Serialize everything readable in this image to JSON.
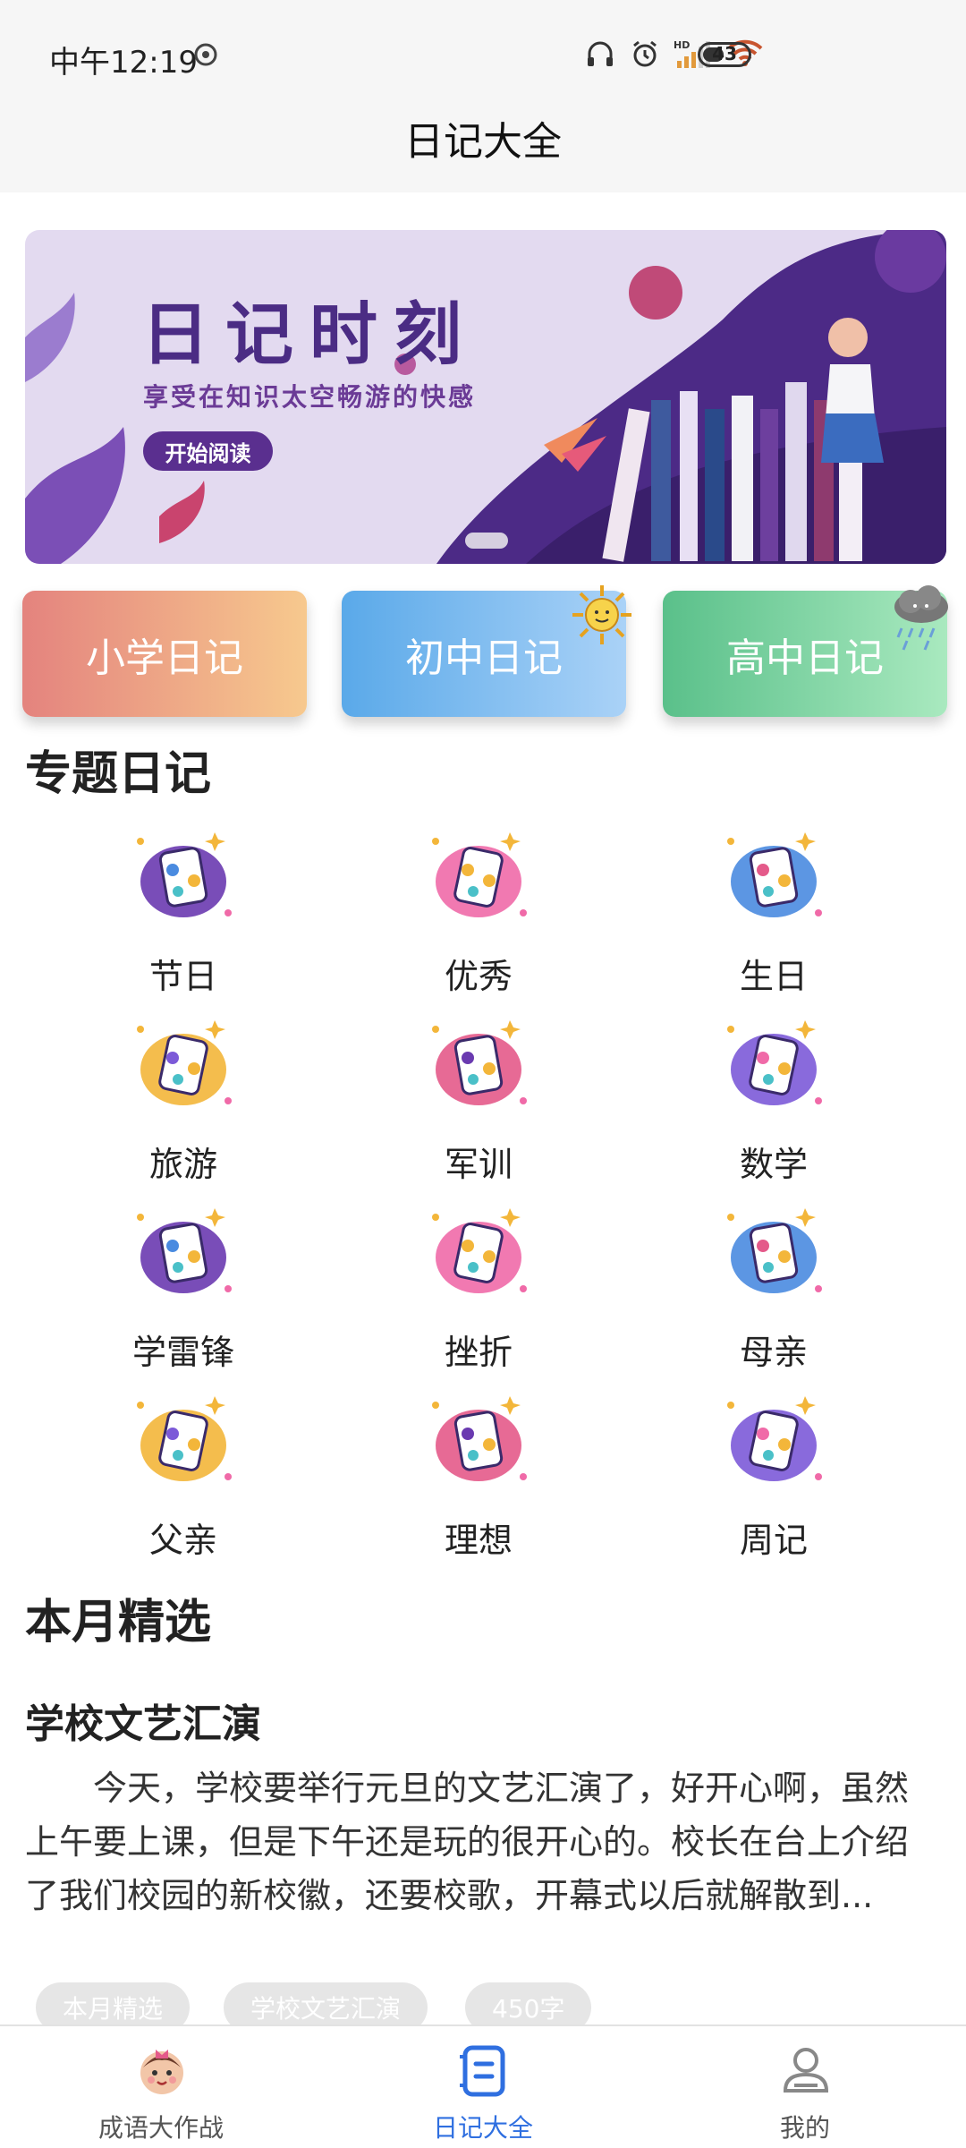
{
  "status_bar": {
    "time": "中午12:19",
    "battery": "43",
    "icons": [
      "sync-icon",
      "headphones-icon",
      "alarm-icon",
      "hd-signal-icon",
      "wifi-icon",
      "battery-icon"
    ]
  },
  "header": {
    "title": "日记大全"
  },
  "banner": {
    "title": "日记时刻",
    "subtitle": "享受在知识太空畅游的快感",
    "button": "开始阅读"
  },
  "categories": [
    {
      "label": "小学日记"
    },
    {
      "label": "初中日记"
    },
    {
      "label": "高中日记"
    }
  ],
  "topics_section": {
    "title": "专题日记"
  },
  "topics": [
    {
      "label": "节日",
      "icon": "palette-icon"
    },
    {
      "label": "优秀",
      "icon": "paint-canvas-icon"
    },
    {
      "label": "生日",
      "icon": "brain-rainbow-icon"
    },
    {
      "label": "旅游",
      "icon": "monitor-icon"
    },
    {
      "label": "军训",
      "icon": "pencil-icon"
    },
    {
      "label": "数学",
      "icon": "open-mind-icon"
    },
    {
      "label": "学雷锋",
      "icon": "crayons-icon"
    },
    {
      "label": "挫折",
      "icon": "lightbulb-icon"
    },
    {
      "label": "母亲",
      "icon": "notebook-icon"
    },
    {
      "label": "父亲",
      "icon": "notepad-pen-icon"
    },
    {
      "label": "理想",
      "icon": "brain-idea-icon"
    },
    {
      "label": "周记",
      "icon": "alarm-clock-icon"
    }
  ],
  "featured_section": {
    "title": "本月精选"
  },
  "article": {
    "title": "学校文艺汇演",
    "excerpt": "今天，学校要举行元旦的文艺汇演了，好开心啊，虽然上午要上课，但是下午还是玩的很开心的。校长在台上介绍了我们校园的新校徽，还要校歌，开幕式以后就解散到...",
    "tags": [
      "本月精选",
      "学校文艺汇演",
      "450字"
    ]
  },
  "bottom_nav": [
    {
      "label": "成语大作战",
      "icon": "baby-face-icon",
      "active": false
    },
    {
      "label": "日记大全",
      "icon": "diary-book-icon",
      "active": true
    },
    {
      "label": "我的",
      "icon": "profile-icon",
      "active": false
    }
  ],
  "colors": {
    "active_tab": "#2f6fe0",
    "tile_primary": "#e4837e",
    "tile_junior": "#5aa9e9",
    "tile_senior": "#5ac08a",
    "banner_purple": "#4b2c84"
  }
}
